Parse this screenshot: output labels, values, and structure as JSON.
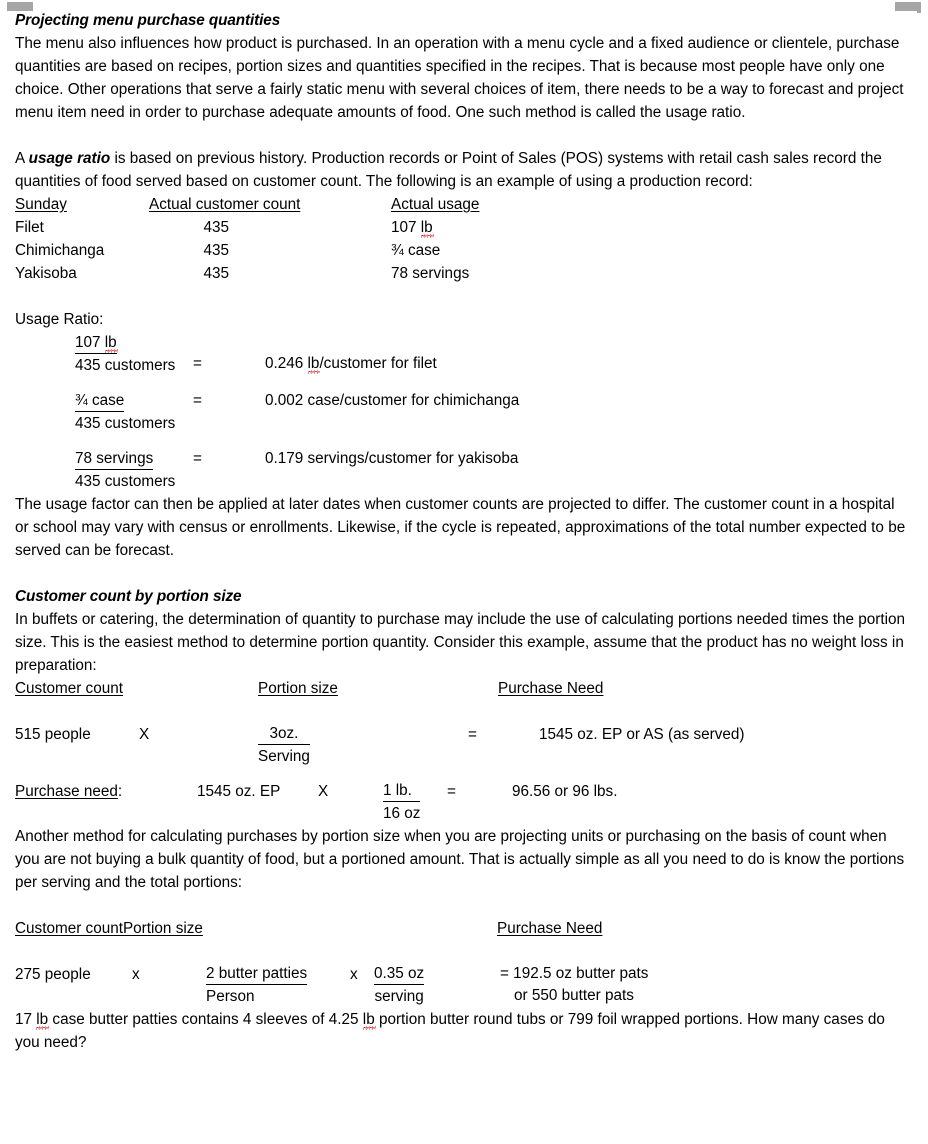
{
  "document": {
    "section1": {
      "heading": "Projecting menu purchase quantities",
      "paragraph": "The menu also influences how product is purchased.  In an operation with a menu cycle and a fixed audience or clientele, purchase quantities are based on recipes, portion sizes and quantities specified in the recipes.  That is because most people have only one choice.  Other operations that serve a fairly static menu with several choices of item, there needs to be a way to forecast and project menu item need in order to purchase adequate amounts of food.   One such method is called the usage ratio.",
      "intro_part1": "A ",
      "intro_emphasis": "usage ratio",
      "intro_part2": " is based on previous history.  Production records or Point of Sales (POS) systems with retail cash sales record the quantities of food served based on customer count.  The following is an example of using a production record:"
    },
    "production_record": {
      "headers": [
        "Sunday",
        "Actual customer count",
        "Actual usage"
      ],
      "rows": [
        {
          "item": "Filet",
          "count": "435",
          "usage_value": "107 ",
          "usage_unit": "lb",
          "usage_rest": ""
        },
        {
          "item": "Chimichanga",
          "count": "435",
          "usage_value": "¾ case",
          "usage_unit": "",
          "usage_rest": ""
        },
        {
          "item": "Yakisoba",
          "count": "435",
          "usage_value": "78 servings",
          "usage_unit": "",
          "usage_rest": ""
        }
      ]
    },
    "usage_ratio": {
      "label": "Usage Ratio:",
      "items": [
        {
          "numerator_pre": "107 ",
          "numerator_misspelled": "lb",
          "numerator_post": "",
          "denominator": "435 customers",
          "equals": "=",
          "result_pre": "0.246 ",
          "result_misspelled": "lb",
          "result_post": "/customer for filet"
        },
        {
          "numerator_pre": "¾ case ",
          "numerator_misspelled": "",
          "numerator_post": "",
          "denominator": "435 customers",
          "equals": "=",
          "result_pre": "0.002 case/customer for chimichanga",
          "result_misspelled": "",
          "result_post": ""
        },
        {
          "numerator_pre": "78 servings",
          "numerator_misspelled": "",
          "numerator_post": "",
          "denominator": "435 customers",
          "equals": "=",
          "result_pre": "0.179 servings/customer for yakisoba",
          "result_misspelled": "",
          "result_post": ""
        }
      ]
    },
    "usage_factor_paragraph": "The usage factor can then be applied at later dates when customer counts are projected to differ.  The customer count in a hospital or school may vary with census or enrollments.  Likewise, if the cycle is repeated, approximations of the total number expected to be served can be forecast.",
    "section2": {
      "heading": "Customer count by portion size",
      "paragraph": "In buffets or catering, the determination of quantity to purchase may include the use of calculating portions needed times the portion size.  This is the easiest method to determine portion quantity.  Consider this example, assume that the product has no weight loss in preparation:"
    },
    "portion_table": {
      "headers": [
        "Customer count",
        "Portion size",
        "Purchase Need"
      ],
      "row1": {
        "customer_count": "515 people",
        "multiply": "X",
        "portion_numerator": "3oz.",
        "portion_denominator": "Serving",
        "equals": "=",
        "purchase_need": "1545 oz. EP or AS (as served)"
      },
      "row2": {
        "label": "Purchase need",
        "label_suffix": ":",
        "value": "1545 oz. EP",
        "multiply": "X",
        "conv_numerator": "1 lb.",
        "conv_denominator": "16 oz",
        "equals": "=",
        "result": "96.56 or 96 lbs."
      }
    },
    "another_method_paragraph": "Another method for calculating purchases by portion size when you are projecting units or purchasing on the basis of count when you are not buying a bulk quantity of food, but a portioned amount.  That is actually simple as all you need to do is know the portions per serving and the total portions:",
    "butter_table": {
      "header_left": "Customer countPortion size",
      "header_right": "Purchase Need",
      "row": {
        "customer_count": "275 people",
        "multiply1": "x",
        "portion_numerator": "2 butter patties",
        "portion_denominator": "Person",
        "multiply2": "x",
        "size_numerator": "0.35 oz",
        "size_denominator": "serving",
        "result_line1": "= 192.5 oz butter pats",
        "result_line2": "or 550 butter pats"
      }
    },
    "closing": {
      "pre": "17 ",
      "misspelled1": "lb",
      "mid1": " case butter patties contains 4 sleeves of 4.25 ",
      "misspelled2": "lb",
      "mid2": " portion butter round tubs or 799 foil wrapped portions.   How many cases do you need?"
    }
  }
}
